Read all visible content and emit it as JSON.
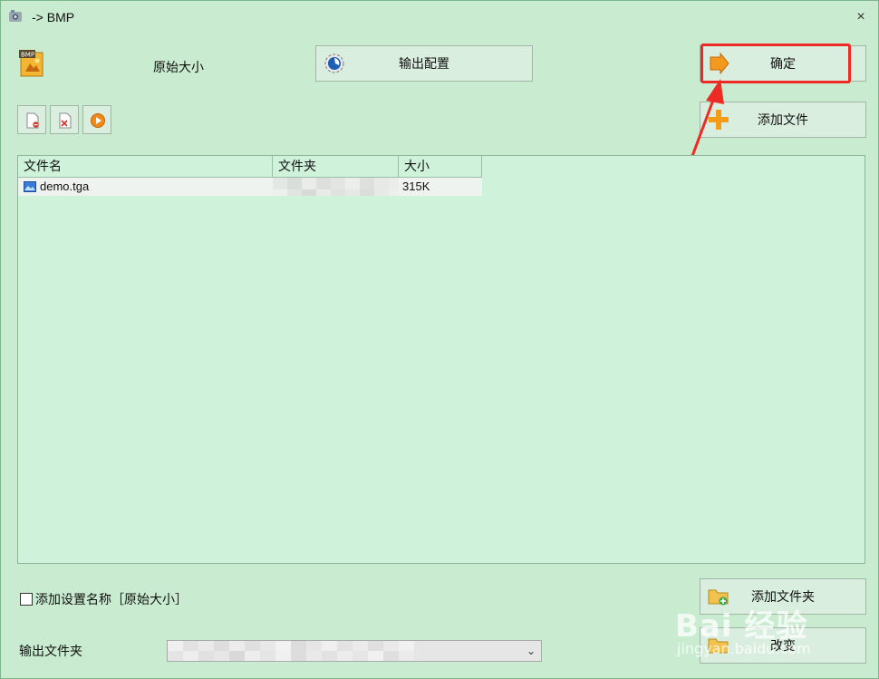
{
  "window": {
    "title": "-> BMP",
    "close_glyph": "×"
  },
  "profile": {
    "label": "原始大小",
    "icon": "bmp-profile-icon"
  },
  "buttons": {
    "output_config": "输出配置",
    "confirm": "确定",
    "add_file": "添加文件",
    "add_folder": "添加文件夹",
    "change": "改变"
  },
  "toolbar": {
    "icons": [
      "remove-file-icon",
      "clear-list-icon",
      "play-icon"
    ]
  },
  "file_list": {
    "columns": [
      "文件名",
      "文件夹",
      "大小"
    ],
    "rows": [
      {
        "name": "demo.tga",
        "folder": "",
        "size": "315K"
      }
    ]
  },
  "options": {
    "add_setting_name_label": "添加设置名称［原始大小］",
    "add_setting_name_checked": false
  },
  "output": {
    "folder_label": "输出文件夹",
    "folder_value": ""
  },
  "watermark": {
    "main": "Bai 经验",
    "sub": "jingyan.baidu.com"
  },
  "colors": {
    "highlight": "#ee2a24",
    "window_bg": "#c9ecd1",
    "list_bg": "#cff2da"
  }
}
